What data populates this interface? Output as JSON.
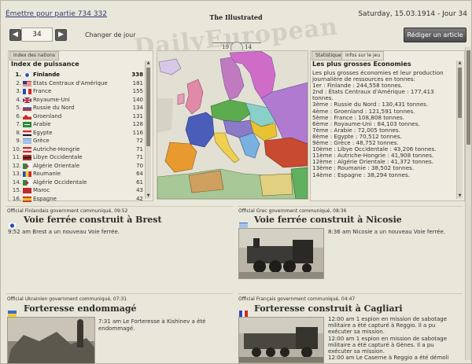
{
  "header": {
    "issue_link": "Émettre pour partie 734 332",
    "date_turn": "Saturday, 15.03.1914 - Jour 34",
    "masthead_small": "The Illustrated",
    "masthead_big": "DailyEuropean",
    "masthead_year_left": "19",
    "masthead_year_right": "14",
    "turn_value": "34",
    "change_day_label": "Changer de jour",
    "write_article_label": "Rédiger un article"
  },
  "nation_index": {
    "tab_label": "Index des nations",
    "title": "Index de puissance",
    "rows": [
      {
        "rank": "1.",
        "name": "Finlande",
        "score": "338",
        "flag": "finland-flag"
      },
      {
        "rank": "2.",
        "name": "États Centraux d'Amérique",
        "score": "181",
        "flag": "usa-flag"
      },
      {
        "rank": "3.",
        "name": "France",
        "score": "155",
        "flag": "france-flag"
      },
      {
        "rank": "4.",
        "name": "Royaume-Uni",
        "score": "140",
        "flag": "uk-flag"
      },
      {
        "rank": "5.",
        "name": "Russie du Nord",
        "score": "134",
        "flag": "russia-flag"
      },
      {
        "rank": "6.",
        "name": "Groenland",
        "score": "131",
        "flag": "greenland-flag"
      },
      {
        "rank": "7.",
        "name": "Arabie",
        "score": "128",
        "flag": "arabia-flag"
      },
      {
        "rank": "8.",
        "name": "Egypte",
        "score": "116",
        "flag": "egypt-flag"
      },
      {
        "rank": "9.",
        "name": "Grèce",
        "score": "72",
        "flag": "greece-flag"
      },
      {
        "rank": "10.",
        "name": "Autriche-Hongrie",
        "score": "71",
        "flag": "austria-flag"
      },
      {
        "rank": "11.",
        "name": "Libye Occidentale",
        "score": "71",
        "flag": "libya-flag"
      },
      {
        "rank": "12.",
        "name": "Algérie Orientale",
        "score": "70",
        "flag": "algeria-flag"
      },
      {
        "rank": "13.",
        "name": "Roumanie",
        "score": "64",
        "flag": "romania-flag"
      },
      {
        "rank": "14.",
        "name": "Algérie Occidentale",
        "score": "61",
        "flag": "algeria-flag"
      },
      {
        "rank": "15.",
        "name": "Maroc",
        "score": "43",
        "flag": "morocco-flag"
      },
      {
        "rank": "16.",
        "name": "Espagne",
        "score": "42",
        "flag": "spain-flag"
      }
    ]
  },
  "economies": {
    "tab_stats": "Statistiques",
    "tab_info": "Infos sur le jeu",
    "title": "Les plus grosses Economies",
    "lines": [
      "Les plus grosses économies et leur production",
      "journalière de ressources en tonnes:",
      "1er : Finlande : 244,558 tonnes.",
      "2nd : États Centraux d'Amérique : 177,413",
      "tonnes.",
      "3ème : Russie du Nord : 130,431 tonnes.",
      "4ème : Groenland : 121,591 tonnes.",
      "5ème : France : 108,808 tonnes.",
      "6ème : Royaume-Uni : 84,103 tonnes.",
      "7ème : Arabie : 72,005 tonnes.",
      "8ème : Egypte : 70,512 tonnes.",
      "9ème : Grèce : 48,752 tonnes.",
      "10ème : Libye Occidentale : 43,206 tonnes.",
      "11ème : Autriche-Hongrie : 41,908 tonnes.",
      "12ème : Algérie Orientale : 41,372 tonnes.",
      "13ème : Roumanie : 38,502 tonnes.",
      "14ème : Espagne : 38,294 tonnes."
    ]
  },
  "articles": [
    {
      "org": "Official Finlandais government communiqué, 09:52",
      "headline": "Voie ferrée construit à Brest",
      "text": "9:52 am Brest a un nouveau Voie ferrée.",
      "flag": "finland-flag"
    },
    {
      "org": "Official Grec government communiqué, 08:36",
      "headline": "Voie ferrée construit à Nicosie",
      "text": "8:36 am Nicosie a un nouveau Voie ferrée.",
      "flag": "greece-flag"
    },
    {
      "org": "Official Ukrainien government communiqué, 07:31",
      "headline": "Forteresse endommagé",
      "text_lines": [
        "7:31 am Le Forteresse à Kishinev a été",
        "endommagé."
      ],
      "flag": "ukraine-flag"
    },
    {
      "org": "Official Français government communiqué, 04:47",
      "headline": "Forteresse construit à Cagliari",
      "text_lines": [
        "12:00 am 1 espion en mission de sabotage",
        "militaire a été capturé à Reggio. Il a pu",
        "exécuter sa mission.",
        "12:00 am 1 espion en mission de sabotage",
        "militaire a été capturé à Gènes. Il a pu",
        "exécuter sa mission.",
        "12:00 am Le Caserne à Reggio a été démoli"
      ],
      "flag": "france-flag"
    }
  ],
  "colors": {
    "background": "#e9e6da",
    "panel": "#eeebe0",
    "link": "#2d3b73",
    "button_dark": "#4c4c4c"
  }
}
